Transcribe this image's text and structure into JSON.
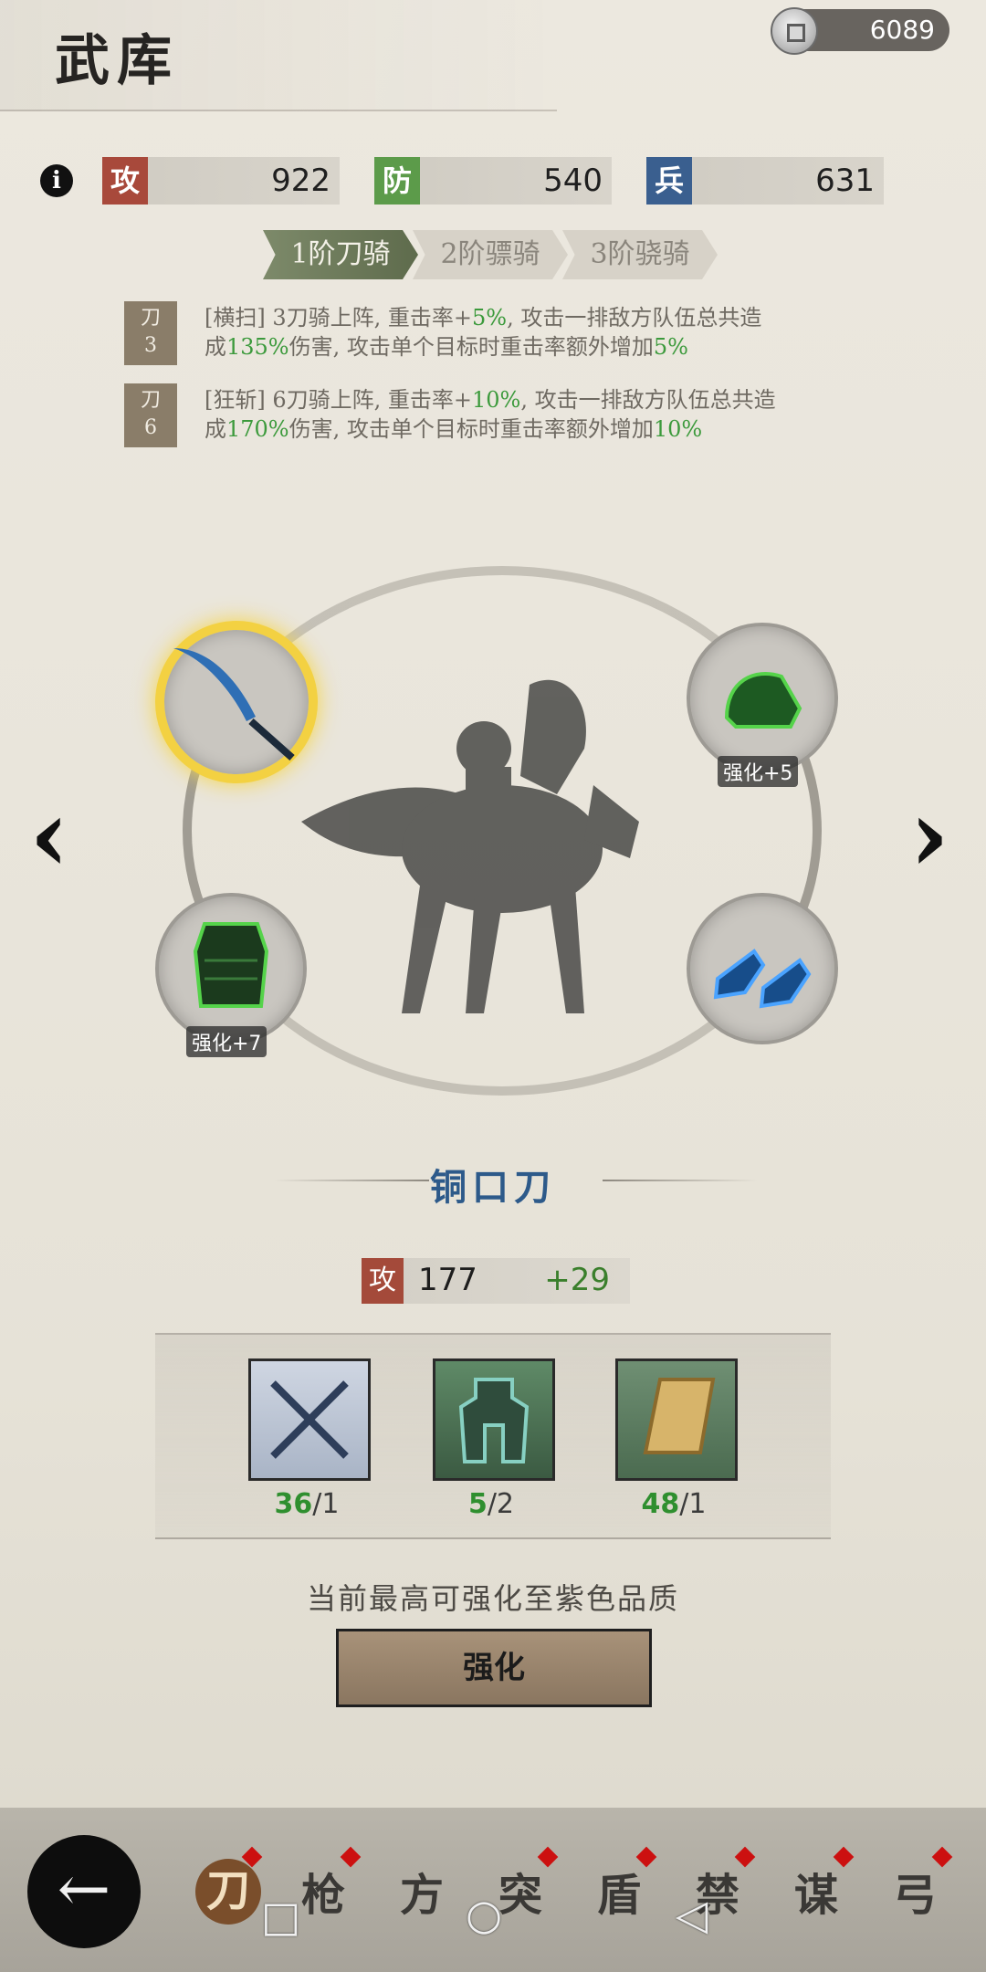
{
  "header": {
    "title": "武库",
    "currency": "6089"
  },
  "stats": [
    {
      "label": "攻",
      "value": "922",
      "color": "#a8493b"
    },
    {
      "label": "防",
      "value": "540",
      "color": "#5c9b4a"
    },
    {
      "label": "兵",
      "value": "631",
      "color": "#3a5f8f"
    }
  ],
  "tabs": [
    {
      "label": "1阶刀骑",
      "active": true
    },
    {
      "label": "2阶骠骑",
      "active": false
    },
    {
      "label": "3阶骁骑",
      "active": false
    }
  ],
  "skills": [
    {
      "badge_top": "刀",
      "badge_num": "3",
      "line1_a": "[横扫] 3刀骑上阵, 重击率+",
      "line1_b": "5%",
      "line1_c": ", 攻击一排敌方队伍总共造",
      "line2_a": "成",
      "line2_b": "135%",
      "line2_c": "伤害, 攻击单个目标时重击率额外增加",
      "line2_d": "5%"
    },
    {
      "badge_top": "刀",
      "badge_num": "6",
      "line1_a": "[狂斩] 6刀骑上阵, 重击率+",
      "line1_b": "10%",
      "line1_c": ", 攻击一排敌方队伍总共造",
      "line2_a": "成",
      "line2_b": "170%",
      "line2_c": "伤害, 攻击单个目标时重击率额外增加",
      "line2_d": "10%"
    }
  ],
  "equipment": {
    "helmet_label": "强化+5",
    "armor_label": "强化+7"
  },
  "item": {
    "name": "铜口刀",
    "stat_label": "攻",
    "stat_value": "177",
    "stat_bonus": "+29"
  },
  "materials": [
    {
      "icon": "crossed-swords-icon",
      "have": "36",
      "need": "/1"
    },
    {
      "icon": "bronze-relic-icon",
      "have": "5",
      "need": "/2"
    },
    {
      "icon": "leather-scroll-icon",
      "have": "48",
      "need": "/1"
    }
  ],
  "hint": "当前最高可强化至紫色品质",
  "enhance_button": "强化",
  "nav": {
    "tabs": [
      "刀",
      "枪",
      "方",
      "突",
      "盾",
      "禁",
      "谋",
      "弓"
    ],
    "active_index": 0
  }
}
